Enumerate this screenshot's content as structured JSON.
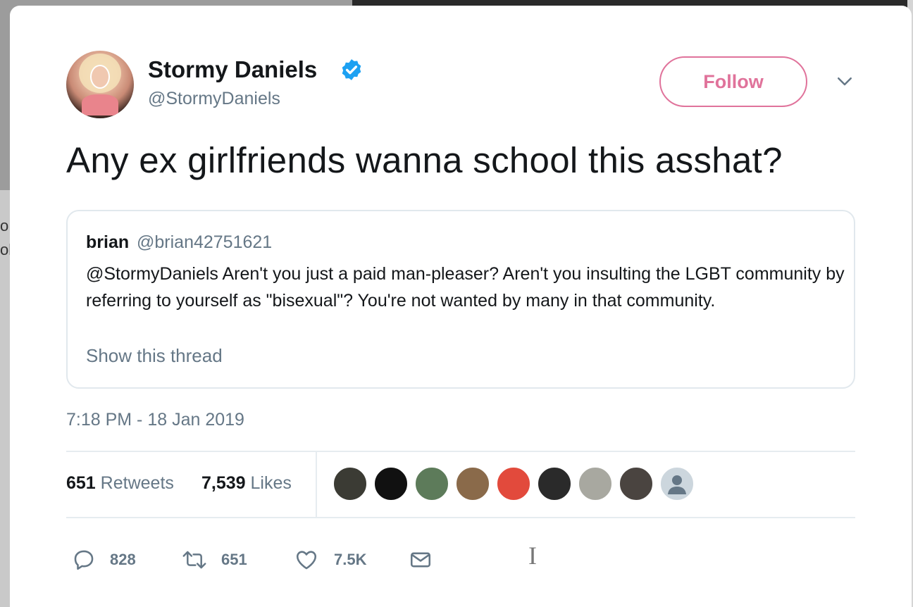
{
  "background": {
    "left_fragments": [
      "o",
      "ol"
    ]
  },
  "tweet": {
    "author": {
      "name": "Stormy Daniels",
      "handle": "@StormyDaniels",
      "verified": true,
      "avatar_icon": "profile-photo"
    },
    "follow_label": "Follow",
    "text": "Any ex girlfriends wanna school this asshat?",
    "quoted": {
      "name": "brian",
      "handle": "@brian42751621",
      "text": "@StormyDaniels Aren't you just a paid man-pleaser?  Aren't you insulting the LGBT community by referring to yourself as \"bisexual\"?  You're not wanted by many in that community.",
      "show_thread": "Show this thread"
    },
    "timestamp": "7:18 PM - 18 Jan 2019",
    "stats": {
      "retweets_count": "651",
      "retweets_label": "Retweets",
      "likes_count": "7,539",
      "likes_label": "Likes"
    },
    "likers": [
      {
        "icon": "liker-avatar-1",
        "color": "#3b3b34"
      },
      {
        "icon": "liker-avatar-2",
        "color": "#111111"
      },
      {
        "icon": "liker-avatar-3",
        "color": "#5d7b5a"
      },
      {
        "icon": "liker-avatar-4",
        "color": "#8a6a4a"
      },
      {
        "icon": "liker-avatar-5",
        "color": "#e24a3c"
      },
      {
        "icon": "liker-avatar-6",
        "color": "#2a2a2a"
      },
      {
        "icon": "liker-avatar-7",
        "color": "#a8a8a0"
      },
      {
        "icon": "liker-avatar-8",
        "color": "#4a4440"
      },
      {
        "icon": "default-avatar",
        "color": "#ccd6dd"
      }
    ],
    "actions": {
      "reply_count": "828",
      "retweet_count": "651",
      "like_count": "7.5K"
    }
  },
  "colors": {
    "follow_accent": "#e0739b",
    "verified_blue": "#1da1f2",
    "muted_text": "#657786"
  }
}
